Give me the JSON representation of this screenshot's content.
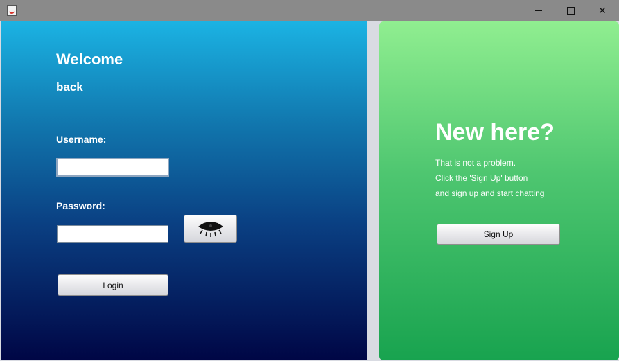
{
  "window": {
    "minimize_glyph": "",
    "maximize_glyph": "",
    "close_glyph": "✕"
  },
  "login": {
    "title_line1": "Welcome",
    "title_line2": "back",
    "username_label": "Username:",
    "username_value": "",
    "password_label": "Password:",
    "password_value": "",
    "show_password_icon": "eye-icon",
    "login_label": "Login"
  },
  "signup": {
    "heading": "New here?",
    "line1": "That is not a problem.",
    "line2": "Click the 'Sign Up' button",
    "line3": "and sign up and start chatting",
    "signup_label": "Sign Up"
  },
  "colors": {
    "left_gradient_top": "#1bb3e3",
    "left_gradient_bottom": "#000645",
    "right_gradient_top": "#90ee90",
    "right_gradient_bottom": "#18a34f"
  }
}
